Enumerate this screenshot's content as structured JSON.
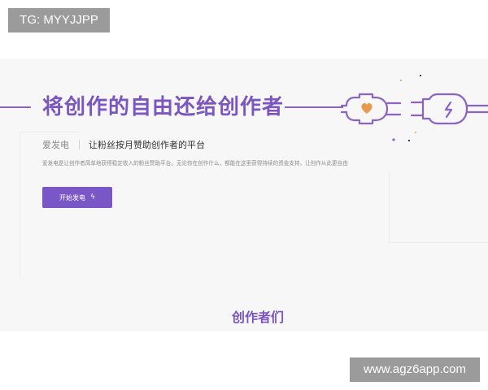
{
  "watermarks": {
    "top_left": "TG: MYYJJPP",
    "bottom_right": "www.agz6app.com"
  },
  "hero": {
    "title": "将创作的自由还给创作者",
    "brand": "爱发电",
    "tagline": "让粉丝按月赞助创作者的平台",
    "description": "爱发电是让创作者简单地获得稳定收入的粉丝赞助平台。无论你在创作什么，都能在这里获得持续的资金支持，让创作从此更自由",
    "start_button": {
      "label": "开始发电",
      "icon": "lightning-icon"
    }
  },
  "creators_section": {
    "title": "创作者们"
  },
  "colors": {
    "accent": "#7b55c0",
    "button": "#7a57c6",
    "hero_background": "#f7f7f8",
    "watermark_background": "#9b9b9b"
  }
}
